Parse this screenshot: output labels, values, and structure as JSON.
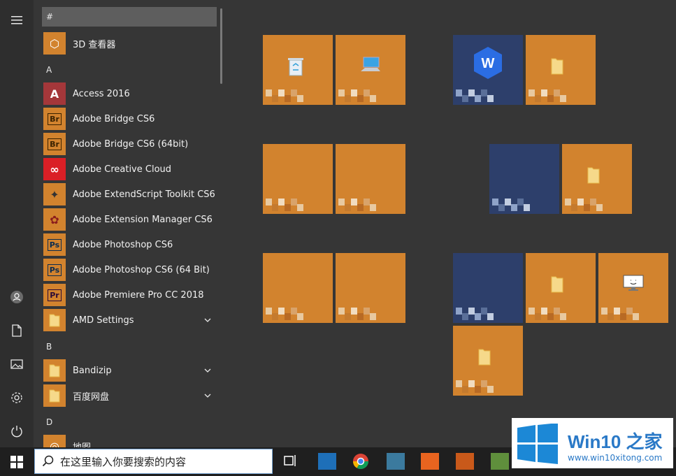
{
  "colors": {
    "accent_tile": "#d2832e",
    "blue_tile": "#2d3f6b",
    "taskbar": "#1f1f1f",
    "start_bg": "#363636"
  },
  "rail": {
    "items": [
      {
        "name": "menu-icon"
      },
      {
        "name": "user-icon"
      },
      {
        "name": "document-icon"
      },
      {
        "name": "pictures-icon"
      },
      {
        "name": "settings-icon"
      },
      {
        "name": "power-icon"
      }
    ]
  },
  "app_list": {
    "headers": {
      "hash": "#",
      "a": "A",
      "b": "B",
      "d": "D"
    },
    "items": [
      {
        "label": "3D 查看器",
        "icon": "3d-viewer-icon",
        "glyph": "⬡",
        "bg": "#d2832e",
        "fg": "#fff"
      },
      {
        "label": "Access 2016",
        "icon": "access-icon",
        "glyph": "A",
        "bg": "#a4373a",
        "fg": "#fff"
      },
      {
        "label": "Adobe Bridge CS6",
        "icon": "bridge-icon",
        "glyph": "Br",
        "bg": "#d2832e",
        "fg": "#3a2200"
      },
      {
        "label": "Adobe Bridge CS6 (64bit)",
        "icon": "bridge-64-icon",
        "glyph": "Br",
        "bg": "#d2832e",
        "fg": "#3a2200"
      },
      {
        "label": "Adobe Creative Cloud",
        "icon": "creative-cloud-icon",
        "glyph": "∞",
        "bg": "#da1f26",
        "fg": "#fff"
      },
      {
        "label": "Adobe ExtendScript Toolkit CS6",
        "icon": "extendscript-icon",
        "glyph": "✦",
        "bg": "#d2832e",
        "fg": "#333"
      },
      {
        "label": "Adobe Extension Manager CS6",
        "icon": "extension-manager-icon",
        "glyph": "✿",
        "bg": "#d2832e",
        "fg": "#8a1c1c"
      },
      {
        "label": "Adobe Photoshop CS6",
        "icon": "photoshop-icon",
        "glyph": "Ps",
        "bg": "#d2832e",
        "fg": "#0a2b4f"
      },
      {
        "label": "Adobe Photoshop CS6 (64 Bit)",
        "icon": "photoshop-64-icon",
        "glyph": "Ps",
        "bg": "#d2832e",
        "fg": "#0a2b4f"
      },
      {
        "label": "Adobe Premiere Pro CC 2018",
        "icon": "premiere-icon",
        "glyph": "Pr",
        "bg": "#d2832e",
        "fg": "#2a0a36"
      },
      {
        "label": "AMD Settings",
        "icon": "folder-icon",
        "glyph": "",
        "bg": "#d2832e",
        "fg": "#f6d98a",
        "chevron": true
      },
      {
        "label": "Bandizip",
        "icon": "folder-icon",
        "glyph": "",
        "bg": "#d2832e",
        "fg": "#f6d98a",
        "chevron": true
      },
      {
        "label": "百度网盘",
        "icon": "folder-icon",
        "glyph": "",
        "bg": "#d2832e",
        "fg": "#f6d98a",
        "chevron": true
      },
      {
        "label": "地图",
        "icon": "maps-icon",
        "glyph": "◎",
        "bg": "#d2832e",
        "fg": "#fff"
      }
    ]
  },
  "tiles": [
    {
      "name": "tile-recycle-bin",
      "icon": "recycle-bin-icon",
      "glyph": "🗑",
      "color": "#d2832e"
    },
    {
      "name": "tile-this-pc",
      "icon": "computer-icon",
      "glyph": "🖥",
      "color": "#d2832e"
    },
    {
      "name": "tile-wps",
      "icon": "wps-icon",
      "glyph": "W",
      "color": "#2d3f6b"
    },
    {
      "name": "tile-folder-1",
      "icon": "folder-icon",
      "glyph": "",
      "color": "#d2832e"
    },
    {
      "name": "tile-app-5",
      "icon": "",
      "glyph": "",
      "color": "#d2832e"
    },
    {
      "name": "tile-app-6",
      "icon": "",
      "glyph": "",
      "color": "#d2832e"
    },
    {
      "name": "tile-blue-2",
      "icon": "",
      "glyph": "",
      "color": "#2d3f6b"
    },
    {
      "name": "tile-folder-2",
      "icon": "folder-icon",
      "glyph": "",
      "color": "#d2832e"
    },
    {
      "name": "tile-app-9",
      "icon": "",
      "glyph": "",
      "color": "#d2832e"
    },
    {
      "name": "tile-app-10",
      "icon": "",
      "glyph": "",
      "color": "#d2832e"
    },
    {
      "name": "tile-blue-3",
      "icon": "",
      "glyph": "",
      "color": "#2d3f6b"
    },
    {
      "name": "tile-folder-3",
      "icon": "folder-icon",
      "glyph": "",
      "color": "#d2832e"
    },
    {
      "name": "tile-monitor",
      "icon": "monitor-icon",
      "glyph": "",
      "color": "#d2832e"
    },
    {
      "name": "tile-folder-4",
      "icon": "folder-icon",
      "glyph": "",
      "color": "#d2832e"
    }
  ],
  "taskbar": {
    "search_placeholder": "在这里输入你要搜索的内容",
    "icons": [
      "task-view-icon",
      "app-icon",
      "chrome-icon",
      "app-icon",
      "app-icon",
      "app-icon",
      "app-icon"
    ]
  },
  "watermark": {
    "title": "Win10 之家",
    "url": "www.win10xitong.com"
  }
}
